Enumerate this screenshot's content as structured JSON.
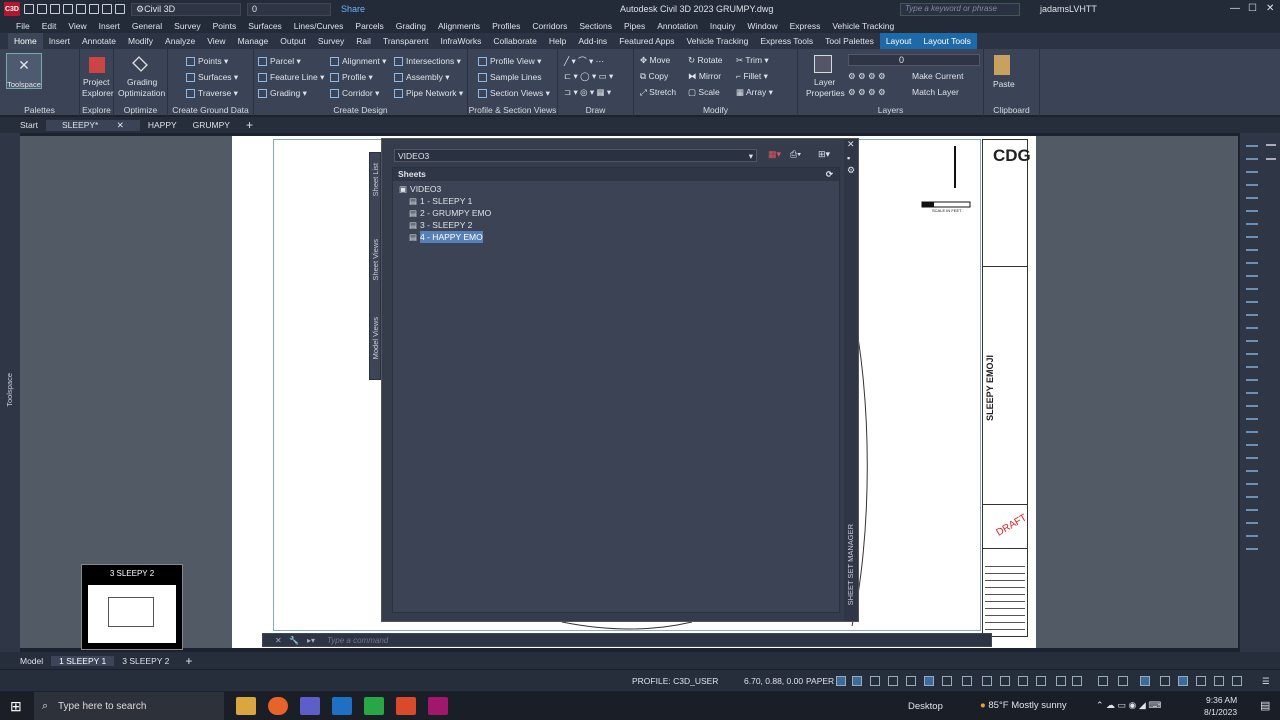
{
  "titlebar": {
    "workspace": "Civil 3D",
    "layer": "0",
    "share": "Share",
    "app_title": "Autodesk Civil 3D 2023    GRUMPY.dwg",
    "search_placeholder": "Type a keyword or phrase",
    "user": "jadamsLVHTT"
  },
  "menu": [
    "File",
    "Edit",
    "View",
    "Insert",
    "General",
    "Survey",
    "Points",
    "Surfaces",
    "Lines/Curves",
    "Parcels",
    "Grading",
    "Alignments",
    "Profiles",
    "Corridors",
    "Sections",
    "Pipes",
    "Annotation",
    "Inquiry",
    "Window",
    "Express",
    "Vehicle Tracking"
  ],
  "tabs": [
    "Home",
    "Insert",
    "Annotate",
    "Modify",
    "Analyze",
    "View",
    "Manage",
    "Output",
    "Survey",
    "Rail",
    "Transparent",
    "InfraWorks",
    "Collaborate",
    "Help",
    "Add-ins",
    "Featured Apps",
    "Vehicle Tracking",
    "Express Tools",
    "Tool Palettes",
    "Layout",
    "Layout Tools"
  ],
  "ribbon": {
    "palettes": {
      "btn": "Toolspace",
      "title": "Palettes"
    },
    "explore": {
      "btn1": "Project",
      "btn2": "Explorer",
      "title": "Explore"
    },
    "optimize": {
      "btn1": "Grading",
      "btn2": "Optimization",
      "title": "Optimize"
    },
    "ground": {
      "i1": "Points",
      "i2": "Surfaces",
      "i3": "Traverse",
      "title": "Create Ground Data"
    },
    "design": {
      "c1": [
        "Parcel",
        "Feature Line",
        "Grading"
      ],
      "c2": [
        "Alignment",
        "Profile",
        "Corridor"
      ],
      "c3": [
        "Intersections",
        "Assembly",
        "Pipe Network"
      ],
      "title": "Create Design"
    },
    "profile": {
      "i1": "Profile View",
      "i2": "Sample Lines",
      "i3": "Section Views",
      "title": "Profile & Section Views"
    },
    "draw": {
      "title": "Draw"
    },
    "modify": {
      "c1": [
        "Move",
        "Copy",
        "Stretch"
      ],
      "c2": [
        "Rotate",
        "Mirror",
        "Scale"
      ],
      "c3": [
        "Trim",
        "Fillet",
        "Array"
      ],
      "title": "Modify"
    },
    "layers": {
      "btn1": "Layer",
      "btn2": "Properties",
      "layer": "0",
      "make_current": "Make Current",
      "match_layer": "Match Layer",
      "title": "Layers"
    },
    "clipboard": {
      "btn": "Paste",
      "title": "Clipboard"
    }
  },
  "doctabs": [
    "Start",
    "SLEEPY*",
    "HAPPY",
    "GRUMPY"
  ],
  "ssm": {
    "sheetset": "VIDEO3",
    "header": "Sheets",
    "root": "VIDEO3",
    "sheets": [
      "1 - SLEEPY 1",
      "2 - GRUMPY EMO",
      "3 - SLEEPY 2",
      "4 - HAPPY EMO"
    ],
    "vtabs": [
      "Sheet List",
      "Sheet Views",
      "Model Views"
    ],
    "side_title": "SHEET SET MANAGER"
  },
  "drawing": {
    "title_block": "SLEEPY EMOJI",
    "draft": "DRAFT",
    "logo": "CDG",
    "scale_label": "SCALE IN FEET"
  },
  "toolspace_label": "Toolspace",
  "command_placeholder": "Type a command",
  "layouts": [
    "Model",
    "1 SLEEPY 1",
    "3 SLEEPY 2"
  ],
  "preview": {
    "title": "3 SLEEPY 2"
  },
  "status": {
    "profile": "PROFILE: C3D_USER",
    "coords": "6.70, 0.88, 0.00",
    "paper": "PAPER"
  },
  "taskbar": {
    "search": "Type here to search",
    "desktop": "Desktop",
    "weather": "85°F  Mostly sunny",
    "time": "9:36 AM",
    "date": "8/1/2023"
  }
}
